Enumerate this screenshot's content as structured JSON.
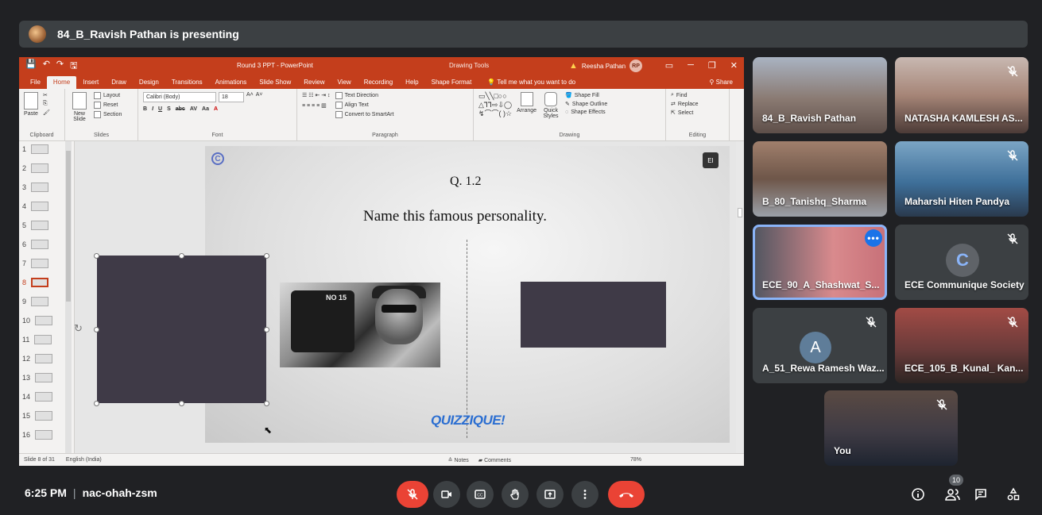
{
  "presenter": {
    "text": "84_B_Ravish Pathan is presenting"
  },
  "ppt": {
    "window_title": "Round 3 PPT - PowerPoint",
    "context_tab": "Drawing Tools",
    "user_name": "Reesha Pathan",
    "user_initials": "RP",
    "quick_access": [
      "💾",
      "↶",
      "↷",
      "🖫"
    ],
    "tabs": [
      "File",
      "Home",
      "Insert",
      "Draw",
      "Design",
      "Transitions",
      "Animations",
      "Slide Show",
      "Review",
      "View",
      "Recording",
      "Help",
      "Shape Format"
    ],
    "active_tab": "Home",
    "tell_me": "Tell me what you want to do",
    "share_label": "Share",
    "ribbon": {
      "clipboard": {
        "label": "Clipboard",
        "paste": "Paste"
      },
      "slides": {
        "label": "Slides",
        "new_slide": "New Slide",
        "layout": "Layout",
        "reset": "Reset",
        "section": "Section"
      },
      "font": {
        "label": "Font",
        "font_name": "Calibri (Body)",
        "font_size": "18"
      },
      "paragraph": {
        "label": "Paragraph",
        "text_direction": "Text Direction",
        "align_text": "Align Text",
        "convert_smartart": "Convert to SmartArt"
      },
      "drawing": {
        "label": "Drawing",
        "arrange": "Arrange",
        "quick_styles": "Quick Styles",
        "shape_fill": "Shape Fill",
        "shape_outline": "Shape Outline",
        "shape_effects": "Shape Effects"
      },
      "editing": {
        "label": "Editing",
        "find": "Find",
        "replace": "Replace",
        "select": "Select"
      }
    },
    "thumbnails": [
      "1",
      "2",
      "3",
      "4",
      "5",
      "6",
      "7",
      "8",
      "9",
      "10",
      "11",
      "12",
      "13",
      "14",
      "15",
      "16"
    ],
    "active_slide": "8",
    "slide": {
      "question": "Q. 1.2",
      "prompt": "Name this famous personality.",
      "camera_text": "NO 15",
      "footer_logo": "QUIZZIQUE!",
      "logo_glyph": "C",
      "chip_glyph": "EI"
    },
    "status": {
      "slide_of": "Slide 8 of 31",
      "language": "English (India)",
      "notes": "Notes",
      "comments": "Comments",
      "zoom": "78%"
    }
  },
  "participants": [
    {
      "name": "84_B_Ravish Pathan",
      "muted": false
    },
    {
      "name": "NATASHA KAMLESH AS...",
      "muted": true
    },
    {
      "name": "B_80_Tanishq_Sharma",
      "muted": false
    },
    {
      "name": "Maharshi Hiten Pandya",
      "muted": true
    },
    {
      "name": "ECE_90_A_Shashwat_S...",
      "muted": false,
      "speaking": true
    },
    {
      "name": "ECE Communique Society",
      "muted": true
    },
    {
      "name": "A_51_Rewa Ramesh Waz...",
      "muted": true,
      "initial": "A"
    },
    {
      "name": "ECE_105_B_Kunal_ Kan...",
      "muted": true
    },
    {
      "name": "You",
      "muted": true
    }
  ],
  "bottom": {
    "time": "6:25 PM",
    "meeting_code": "nac-ohah-zsm",
    "participant_count": "10"
  },
  "colors": {
    "accent_red": "#ea4335",
    "ppt_orange": "#c43e1c",
    "speaker_outline": "#8ab4f8",
    "bar_bg": "#3c4043"
  }
}
